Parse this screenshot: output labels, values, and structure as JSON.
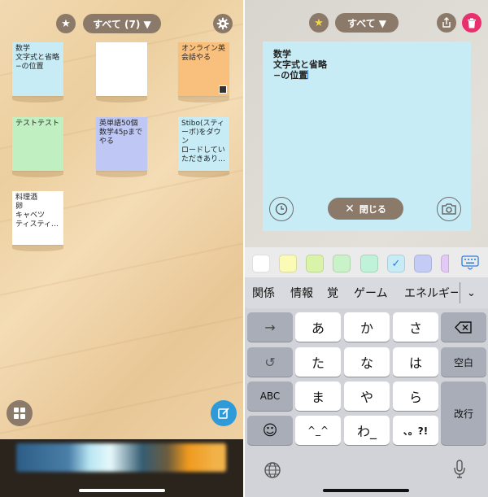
{
  "left_screen": {
    "filter_label": "すべて (7) ▼",
    "notes": [
      {
        "text": "数学\n文字式と省略\n−の位置",
        "color": "#c7ecf6"
      },
      {
        "text": "",
        "color": "#ffffff"
      },
      {
        "text": "オンライン英\n会話やる",
        "color": "#f9c07d"
      },
      {
        "text": "テストテスト",
        "color": "#c0f0c2"
      },
      {
        "text": "英単語50個\n数学45pまで\nやる",
        "color": "#bfc8f4"
      },
      {
        "text": "Stibo(スティ\nーボ)をダウン\nロードしてい\nただきあり…",
        "color": "#c7ecf6"
      },
      {
        "text": "料理酒\n卵\nキャベツ\nティスティ…",
        "color": "#ffffff"
      }
    ]
  },
  "right_screen": {
    "filter_label": "すべて ▼",
    "editor_text": "数学\n文字式と省略\n−の位置",
    "close_label": "閉じる",
    "palette_colors": [
      "#ffffff",
      "#fbfbb6",
      "#d9f4a8",
      "#c9f2c9",
      "#bff2d8",
      "#c7ecf6",
      "#c4ccf6",
      "#e3c9f6"
    ],
    "suggestions": [
      "関係",
      "情報",
      "覚",
      "ゲーム",
      "エネルギー"
    ],
    "keys": {
      "arrow": "→",
      "a": "あ",
      "ka": "か",
      "sa": "さ",
      "undo": "↺",
      "ta": "た",
      "na": "な",
      "ha": "は",
      "space": "空白",
      "abc": "ABC",
      "ma": "ま",
      "ya": "や",
      "ra": "ら",
      "return": "改行",
      "emoji": "☺",
      "kaomoji": "^_^",
      "wa": "わ_",
      "punct": "、。?!"
    }
  }
}
